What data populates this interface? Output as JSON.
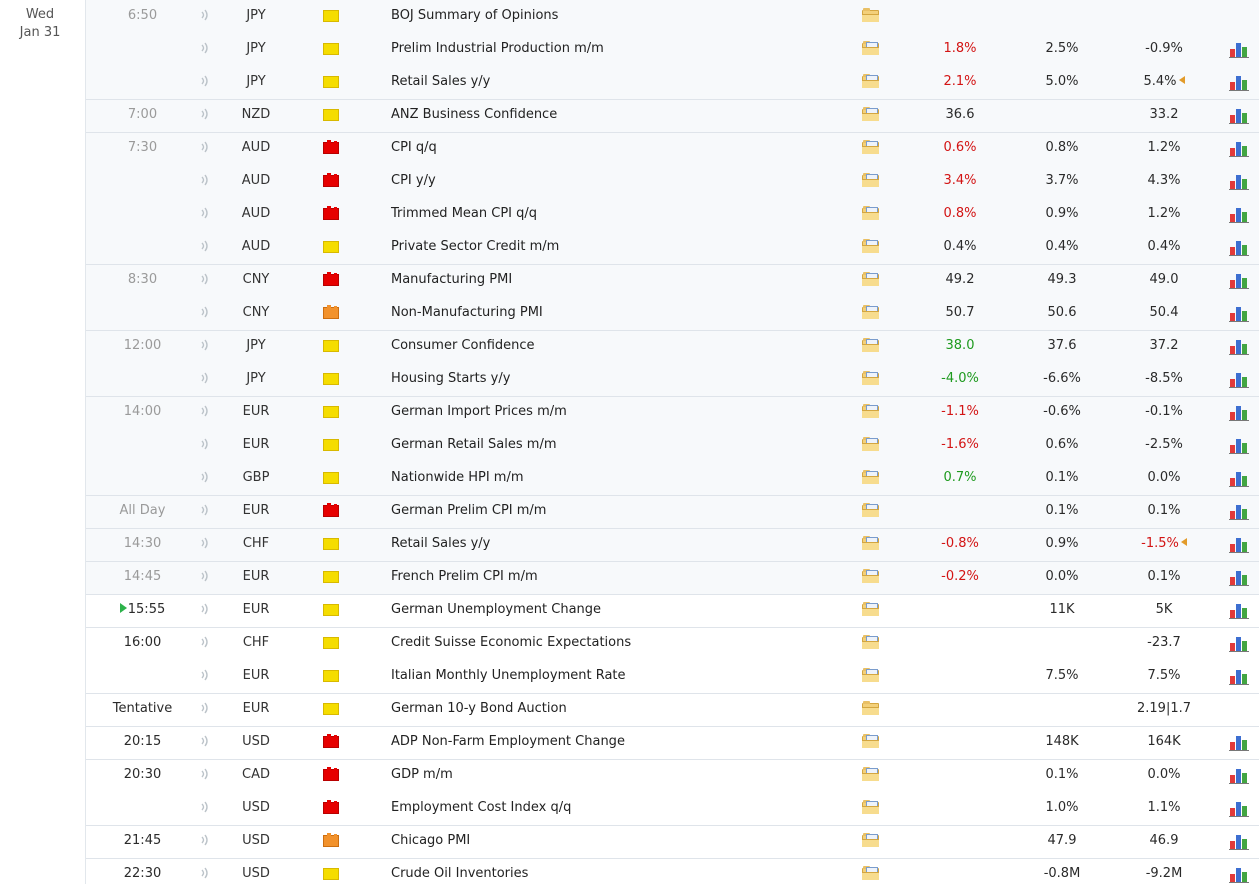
{
  "date": {
    "dow": "Wed",
    "day": "Jan 31"
  },
  "icons": {
    "speaker": "speaker-icon",
    "detail": "folder-icon",
    "chart": "bar-chart-icon",
    "revised": "revised-arrow-icon",
    "now": "play-icon"
  },
  "colors": {
    "actual_better": "#1e9a1e",
    "actual_worse": "#d31414",
    "impact_high": "#e60000",
    "impact_medium": "#f2922c",
    "impact_low": "#f5dd00"
  },
  "rows": [
    {
      "time": "6:50",
      "currency": "JPY",
      "impact": "yellow",
      "event": "BOJ Summary of Opinions",
      "actual": "",
      "forecast": "",
      "previous": "",
      "chart": false
    },
    {
      "time": "",
      "currency": "JPY",
      "impact": "yellow",
      "event": "Prelim Industrial Production m/m",
      "actual": "1.8%",
      "actual_color": "red",
      "forecast": "2.5%",
      "previous": "-0.9%",
      "chart": true
    },
    {
      "time": "",
      "currency": "JPY",
      "impact": "yellow",
      "event": "Retail Sales y/y",
      "actual": "2.1%",
      "actual_color": "red",
      "forecast": "5.0%",
      "previous": "5.4%",
      "revised": true,
      "chart": true
    },
    {
      "time": "7:00",
      "currency": "NZD",
      "impact": "yellow",
      "event": "ANZ Business Confidence",
      "actual": "36.6",
      "forecast": "",
      "previous": "33.2",
      "chart": true
    },
    {
      "time": "7:30",
      "currency": "AUD",
      "impact": "red",
      "event": "CPI q/q",
      "actual": "0.6%",
      "actual_color": "red",
      "forecast": "0.8%",
      "previous": "1.2%",
      "chart": true
    },
    {
      "time": "",
      "currency": "AUD",
      "impact": "red",
      "event": "CPI y/y",
      "actual": "3.4%",
      "actual_color": "red",
      "forecast": "3.7%",
      "previous": "4.3%",
      "chart": true
    },
    {
      "time": "",
      "currency": "AUD",
      "impact": "red",
      "event": "Trimmed Mean CPI q/q",
      "actual": "0.8%",
      "actual_color": "red",
      "forecast": "0.9%",
      "previous": "1.2%",
      "chart": true
    },
    {
      "time": "",
      "currency": "AUD",
      "impact": "yellow",
      "event": "Private Sector Credit m/m",
      "actual": "0.4%",
      "forecast": "0.4%",
      "previous": "0.4%",
      "chart": true
    },
    {
      "time": "8:30",
      "currency": "CNY",
      "impact": "red",
      "event": "Manufacturing PMI",
      "actual": "49.2",
      "forecast": "49.3",
      "previous": "49.0",
      "chart": true
    },
    {
      "time": "",
      "currency": "CNY",
      "impact": "orange",
      "event": "Non-Manufacturing PMI",
      "actual": "50.7",
      "forecast": "50.6",
      "previous": "50.4",
      "chart": true
    },
    {
      "time": "12:00",
      "currency": "JPY",
      "impact": "yellow",
      "event": "Consumer Confidence",
      "actual": "38.0",
      "actual_color": "green",
      "forecast": "37.6",
      "previous": "37.2",
      "chart": true
    },
    {
      "time": "",
      "currency": "JPY",
      "impact": "yellow",
      "event": "Housing Starts y/y",
      "actual": "-4.0%",
      "actual_color": "green",
      "forecast": "-6.6%",
      "previous": "-8.5%",
      "chart": true
    },
    {
      "time": "14:00",
      "currency": "EUR",
      "impact": "yellow",
      "event": "German Import Prices m/m",
      "actual": "-1.1%",
      "actual_color": "red",
      "forecast": "-0.6%",
      "previous": "-0.1%",
      "chart": true
    },
    {
      "time": "",
      "currency": "EUR",
      "impact": "yellow",
      "event": "German Retail Sales m/m",
      "actual": "-1.6%",
      "actual_color": "red",
      "forecast": "0.6%",
      "previous": "-2.5%",
      "chart": true
    },
    {
      "time": "",
      "currency": "GBP",
      "impact": "yellow",
      "event": "Nationwide HPI m/m",
      "actual": "0.7%",
      "actual_color": "green",
      "forecast": "0.1%",
      "previous": "0.0%",
      "chart": true
    },
    {
      "time": "All Day",
      "currency": "EUR",
      "impact": "red",
      "event": "German Prelim CPI m/m",
      "actual": "",
      "forecast": "0.1%",
      "previous": "0.1%",
      "chart": true
    },
    {
      "time": "14:30",
      "currency": "CHF",
      "impact": "yellow",
      "event": "Retail Sales y/y",
      "actual": "-0.8%",
      "actual_color": "red",
      "forecast": "0.9%",
      "previous": "-1.5%",
      "previous_color": "red",
      "revised": true,
      "chart": true
    },
    {
      "time": "14:45",
      "currency": "EUR",
      "impact": "yellow",
      "event": "French Prelim CPI m/m",
      "actual": "-0.2%",
      "actual_color": "red",
      "forecast": "0.0%",
      "previous": "0.1%",
      "chart": true
    },
    {
      "time": "15:55",
      "currency": "EUR",
      "impact": "yellow",
      "event": "German Unemployment Change",
      "actual": "",
      "forecast": "11K",
      "previous": "5K",
      "chart": true,
      "now": true
    },
    {
      "time": "16:00",
      "currency": "CHF",
      "impact": "yellow",
      "event": "Credit Suisse Economic Expectations",
      "actual": "",
      "forecast": "",
      "previous": "-23.7",
      "chart": true
    },
    {
      "time": "",
      "currency": "EUR",
      "impact": "yellow",
      "event": "Italian Monthly Unemployment Rate",
      "actual": "",
      "forecast": "7.5%",
      "previous": "7.5%",
      "chart": true
    },
    {
      "time": "Tentative",
      "currency": "EUR",
      "impact": "yellow",
      "event": "German 10-y Bond Auction",
      "actual": "",
      "forecast": "",
      "previous": "2.19|1.7",
      "chart": false
    },
    {
      "time": "20:15",
      "currency": "USD",
      "impact": "red",
      "event": "ADP Non-Farm Employment Change",
      "actual": "",
      "forecast": "148K",
      "previous": "164K",
      "chart": true
    },
    {
      "time": "20:30",
      "currency": "CAD",
      "impact": "red",
      "event": "GDP m/m",
      "actual": "",
      "forecast": "0.1%",
      "previous": "0.0%",
      "chart": true
    },
    {
      "time": "",
      "currency": "USD",
      "impact": "red",
      "event": "Employment Cost Index q/q",
      "actual": "",
      "forecast": "1.0%",
      "previous": "1.1%",
      "chart": true
    },
    {
      "time": "21:45",
      "currency": "USD",
      "impact": "orange",
      "event": "Chicago PMI",
      "actual": "",
      "forecast": "47.9",
      "previous": "46.9",
      "chart": true
    },
    {
      "time": "22:30",
      "currency": "USD",
      "impact": "yellow",
      "event": "Crude Oil Inventories",
      "actual": "",
      "forecast": "-0.8M",
      "previous": "-9.2M",
      "chart": true
    }
  ]
}
